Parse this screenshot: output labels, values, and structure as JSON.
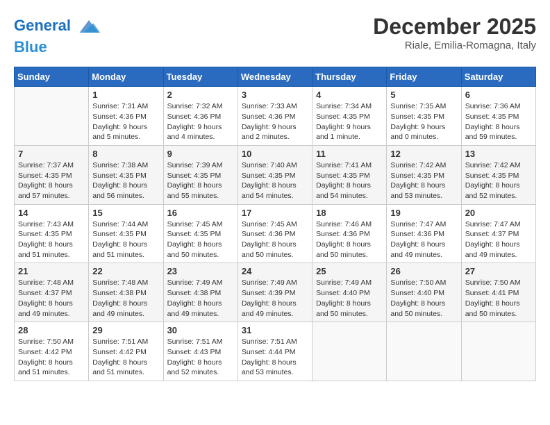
{
  "header": {
    "logo_line1": "General",
    "logo_line2": "Blue",
    "month": "December 2025",
    "location": "Riale, Emilia-Romagna, Italy"
  },
  "days_of_week": [
    "Sunday",
    "Monday",
    "Tuesday",
    "Wednesday",
    "Thursday",
    "Friday",
    "Saturday"
  ],
  "weeks": [
    [
      {
        "day": "",
        "content": ""
      },
      {
        "day": "1",
        "content": "Sunrise: 7:31 AM\nSunset: 4:36 PM\nDaylight: 9 hours\nand 5 minutes."
      },
      {
        "day": "2",
        "content": "Sunrise: 7:32 AM\nSunset: 4:36 PM\nDaylight: 9 hours\nand 4 minutes."
      },
      {
        "day": "3",
        "content": "Sunrise: 7:33 AM\nSunset: 4:36 PM\nDaylight: 9 hours\nand 2 minutes."
      },
      {
        "day": "4",
        "content": "Sunrise: 7:34 AM\nSunset: 4:35 PM\nDaylight: 9 hours\nand 1 minute."
      },
      {
        "day": "5",
        "content": "Sunrise: 7:35 AM\nSunset: 4:35 PM\nDaylight: 9 hours\nand 0 minutes."
      },
      {
        "day": "6",
        "content": "Sunrise: 7:36 AM\nSunset: 4:35 PM\nDaylight: 8 hours\nand 59 minutes."
      }
    ],
    [
      {
        "day": "7",
        "content": "Sunrise: 7:37 AM\nSunset: 4:35 PM\nDaylight: 8 hours\nand 57 minutes."
      },
      {
        "day": "8",
        "content": "Sunrise: 7:38 AM\nSunset: 4:35 PM\nDaylight: 8 hours\nand 56 minutes."
      },
      {
        "day": "9",
        "content": "Sunrise: 7:39 AM\nSunset: 4:35 PM\nDaylight: 8 hours\nand 55 minutes."
      },
      {
        "day": "10",
        "content": "Sunrise: 7:40 AM\nSunset: 4:35 PM\nDaylight: 8 hours\nand 54 minutes."
      },
      {
        "day": "11",
        "content": "Sunrise: 7:41 AM\nSunset: 4:35 PM\nDaylight: 8 hours\nand 54 minutes."
      },
      {
        "day": "12",
        "content": "Sunrise: 7:42 AM\nSunset: 4:35 PM\nDaylight: 8 hours\nand 53 minutes."
      },
      {
        "day": "13",
        "content": "Sunrise: 7:42 AM\nSunset: 4:35 PM\nDaylight: 8 hours\nand 52 minutes."
      }
    ],
    [
      {
        "day": "14",
        "content": "Sunrise: 7:43 AM\nSunset: 4:35 PM\nDaylight: 8 hours\nand 51 minutes."
      },
      {
        "day": "15",
        "content": "Sunrise: 7:44 AM\nSunset: 4:35 PM\nDaylight: 8 hours\nand 51 minutes."
      },
      {
        "day": "16",
        "content": "Sunrise: 7:45 AM\nSunset: 4:35 PM\nDaylight: 8 hours\nand 50 minutes."
      },
      {
        "day": "17",
        "content": "Sunrise: 7:45 AM\nSunset: 4:36 PM\nDaylight: 8 hours\nand 50 minutes."
      },
      {
        "day": "18",
        "content": "Sunrise: 7:46 AM\nSunset: 4:36 PM\nDaylight: 8 hours\nand 50 minutes."
      },
      {
        "day": "19",
        "content": "Sunrise: 7:47 AM\nSunset: 4:36 PM\nDaylight: 8 hours\nand 49 minutes."
      },
      {
        "day": "20",
        "content": "Sunrise: 7:47 AM\nSunset: 4:37 PM\nDaylight: 8 hours\nand 49 minutes."
      }
    ],
    [
      {
        "day": "21",
        "content": "Sunrise: 7:48 AM\nSunset: 4:37 PM\nDaylight: 8 hours\nand 49 minutes."
      },
      {
        "day": "22",
        "content": "Sunrise: 7:48 AM\nSunset: 4:38 PM\nDaylight: 8 hours\nand 49 minutes."
      },
      {
        "day": "23",
        "content": "Sunrise: 7:49 AM\nSunset: 4:38 PM\nDaylight: 8 hours\nand 49 minutes."
      },
      {
        "day": "24",
        "content": "Sunrise: 7:49 AM\nSunset: 4:39 PM\nDaylight: 8 hours\nand 49 minutes."
      },
      {
        "day": "25",
        "content": "Sunrise: 7:49 AM\nSunset: 4:40 PM\nDaylight: 8 hours\nand 50 minutes."
      },
      {
        "day": "26",
        "content": "Sunrise: 7:50 AM\nSunset: 4:40 PM\nDaylight: 8 hours\nand 50 minutes."
      },
      {
        "day": "27",
        "content": "Sunrise: 7:50 AM\nSunset: 4:41 PM\nDaylight: 8 hours\nand 50 minutes."
      }
    ],
    [
      {
        "day": "28",
        "content": "Sunrise: 7:50 AM\nSunset: 4:42 PM\nDaylight: 8 hours\nand 51 minutes."
      },
      {
        "day": "29",
        "content": "Sunrise: 7:51 AM\nSunset: 4:42 PM\nDaylight: 8 hours\nand 51 minutes."
      },
      {
        "day": "30",
        "content": "Sunrise: 7:51 AM\nSunset: 4:43 PM\nDaylight: 8 hours\nand 52 minutes."
      },
      {
        "day": "31",
        "content": "Sunrise: 7:51 AM\nSunset: 4:44 PM\nDaylight: 8 hours\nand 53 minutes."
      },
      {
        "day": "",
        "content": ""
      },
      {
        "day": "",
        "content": ""
      },
      {
        "day": "",
        "content": ""
      }
    ]
  ]
}
